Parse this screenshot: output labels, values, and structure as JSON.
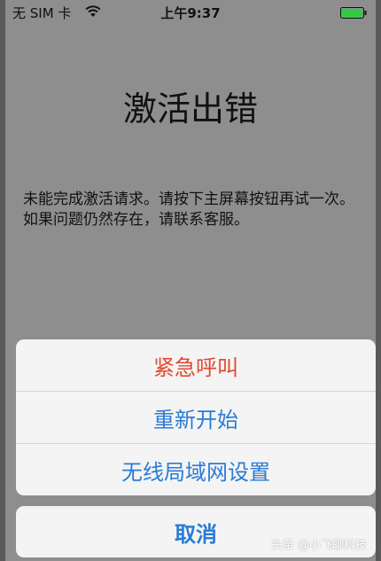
{
  "status_bar": {
    "carrier": "无 SIM 卡",
    "time": "上午9:37",
    "wifi_icon": "wifi-icon",
    "battery_icon": "battery-icon",
    "battery_color": "#2ecc40"
  },
  "main": {
    "title": "激活出错",
    "message": "未能完成激活请求。请按下主屏幕按钮再试一次。如果问题仍然存在，请联系客服。"
  },
  "action_sheet": {
    "items": [
      {
        "label": "紧急呼叫",
        "color": "#e3492e"
      },
      {
        "label": "重新开始",
        "color": "#2a7bd6"
      },
      {
        "label": "无线局域网设置",
        "color": "#2a7bd6"
      }
    ],
    "cancel_label": "取消"
  },
  "watermark": "头条 @小飞聊科技"
}
